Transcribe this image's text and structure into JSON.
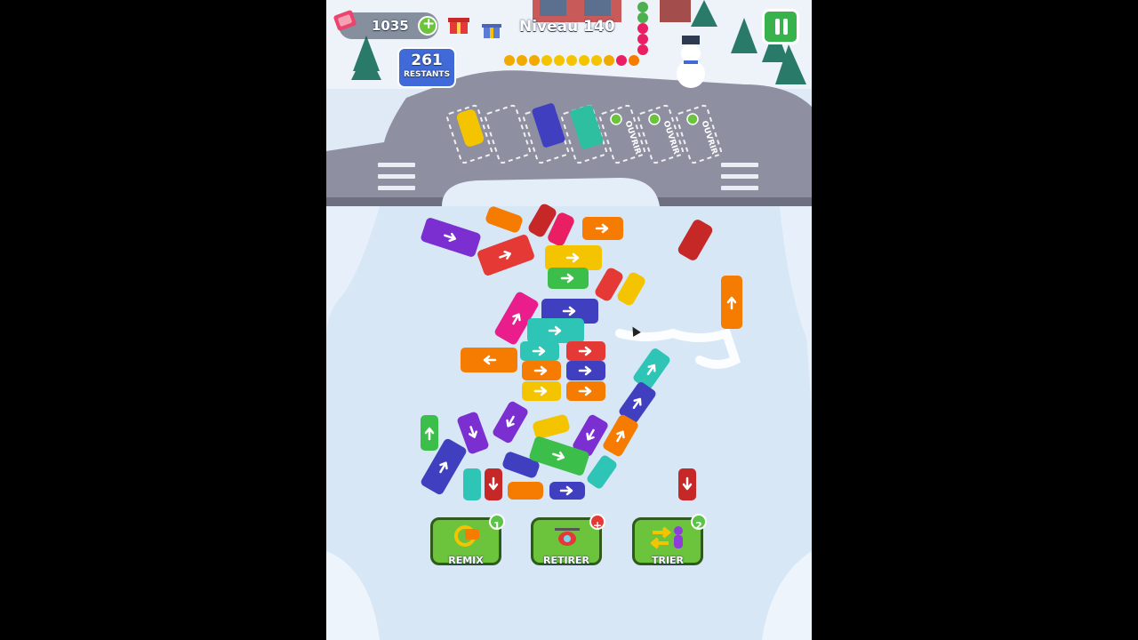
{
  "hud": {
    "coins": "1035",
    "level_title": "Niveau 140",
    "remaining_count": "261",
    "remaining_label": "RESTANTS"
  },
  "parking": {
    "locked_slot_label": "OUVRIR",
    "locked_slots": 3
  },
  "boosters": [
    {
      "label": "REMIX",
      "badge": "1",
      "badge_color": "#5cc34a",
      "icon": "remix-car-icon"
    },
    {
      "label": "RETIRER",
      "badge": "+",
      "badge_color": "#e53935",
      "icon": "helicopter-icon"
    },
    {
      "label": "TRIER",
      "badge": "2",
      "badge_color": "#5cc34a",
      "icon": "swap-person-icon"
    }
  ],
  "colors": {
    "button_green": "#6cc43c",
    "pause_green": "#37b24d",
    "remaining_blue": "#3f6ad8",
    "road": "#8d8e9e",
    "snow": "#eaf2fb"
  }
}
